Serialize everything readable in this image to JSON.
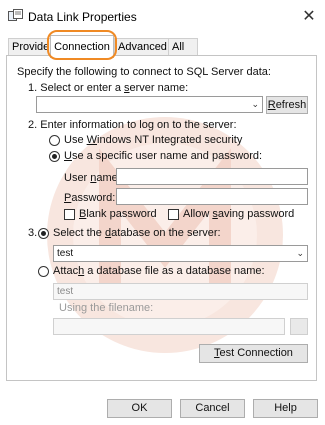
{
  "window": {
    "title": "Data Link Properties",
    "close_glyph": "✕"
  },
  "tabs": [
    {
      "label": "Provider"
    },
    {
      "label": "Connection"
    },
    {
      "label": "Advanced"
    },
    {
      "label": "All"
    }
  ],
  "connection": {
    "intro": "Specify the following to connect to SQL Server data:",
    "step1": {
      "num": "1.",
      "pre": "Select or enter a ",
      "ul": "s",
      "post": "erver name:",
      "server_value": "",
      "refresh_ul": "R",
      "refresh_rest": "efresh"
    },
    "step2": {
      "num": "2.",
      "label": "Enter information to log on to the server:",
      "opt_windows": {
        "pre": "Use ",
        "ul": "W",
        "post": "indows NT Integrated security"
      },
      "opt_specific": {
        "ul": "U",
        "post": "se a specific user name and password:"
      },
      "user_label": {
        "pre": "User ",
        "ul": "n",
        "post": "ame:"
      },
      "user_value": "",
      "password_label": {
        "ul": "P",
        "post": "assword:"
      },
      "password_value": "",
      "blank_pw": {
        "ul": "B",
        "post": "lank password"
      },
      "allow_save": {
        "pre": "Allow ",
        "ul": "s",
        "post": "aving password"
      }
    },
    "step3": {
      "num": "3.",
      "opt_select": {
        "pre": "Select the ",
        "ul": "d",
        "post": "atabase on the server:"
      },
      "database_value": "test",
      "opt_attach": {
        "pre": "Attac",
        "ul": "h",
        "post": " a database file as a database name:"
      },
      "attach_name_value": "test",
      "filename_label": "Using the filename:",
      "filename_value": ""
    },
    "test_button": {
      "ul": "T",
      "post": "est Connection"
    }
  },
  "footer": {
    "ok": "OK",
    "cancel": "Cancel",
    "help": "Help"
  },
  "colors": {
    "highlight": "#f08a24",
    "watermark": "#f6e3dd"
  }
}
